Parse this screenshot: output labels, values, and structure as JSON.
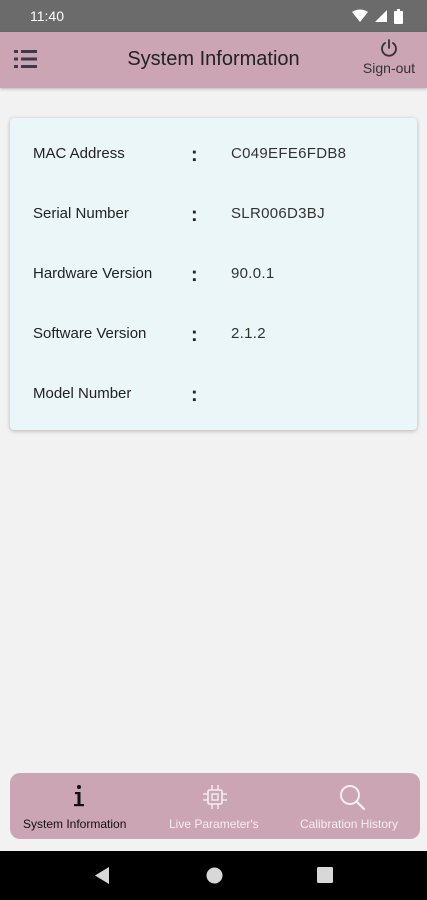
{
  "status_bar": {
    "time": "11:40"
  },
  "app_bar": {
    "title": "System Information",
    "signout_label": "Sign-out"
  },
  "info": {
    "rows": [
      {
        "label": "MAC Address",
        "value": "C049EFE6FDB8"
      },
      {
        "label": "Serial Number",
        "value": "SLR006D3BJ"
      },
      {
        "label": "Hardware Version",
        "value": "90.0.1"
      },
      {
        "label": "Software Version",
        "value": "2.1.2"
      },
      {
        "label": "Model Number",
        "value": ""
      }
    ],
    "separator": ":"
  },
  "bottom_nav": {
    "items": [
      {
        "label": "System Information",
        "icon": "info-icon",
        "active": true
      },
      {
        "label": "Live Parameter's",
        "icon": "chip-icon",
        "active": false
      },
      {
        "label": "Calibration History",
        "icon": "search-icon",
        "active": false
      }
    ]
  },
  "colors": {
    "app_bar": "#cba5b3",
    "card_bg": "#eaf6f7",
    "page_bg": "#f2f2f2",
    "status_bar": "#6b6b6b"
  }
}
